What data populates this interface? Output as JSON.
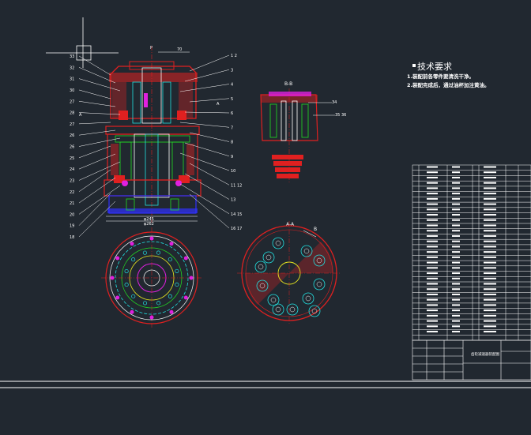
{
  "canvas": {
    "background": "#212830"
  },
  "colors": {
    "red": "#e02020",
    "white": "#ffffff",
    "cyan": "#22e0e0",
    "green": "#22dd22",
    "blue": "#3030ff",
    "magenta": "#e020e0",
    "yellow": "#e8e820"
  },
  "technical_requirements": {
    "title": "技术要求",
    "lines": [
      "1.装配前各零件要清洗干净。",
      "2.装配完成后，通过油杯加注黄油。"
    ]
  },
  "main_view": {
    "top_label": "P",
    "top_dimension": "70",
    "bottom_dimension_1": "φ245",
    "bottom_dimension_2": "φ262",
    "left_callouts": [
      "33",
      "32",
      "31",
      "30",
      "27",
      "28",
      "27",
      "26",
      "26",
      "25",
      "24",
      "23",
      "22",
      "21",
      "20",
      "19",
      "18"
    ],
    "right_callouts": [
      "1 2",
      "3",
      "4",
      "5",
      "6",
      "7",
      "8",
      "9",
      "10",
      "11 12",
      "13",
      "14 15",
      "16 17"
    ],
    "section_marks": [
      "A",
      "A"
    ]
  },
  "section_bb": {
    "title": "B-B",
    "callouts": [
      "34",
      "35 36"
    ]
  },
  "section_aa": {
    "title": "A-A",
    "mark": "B"
  },
  "title_block": {
    "drawing_name": "齿轮减速器装配图"
  },
  "parts_list": {
    "row_count": 33
  }
}
